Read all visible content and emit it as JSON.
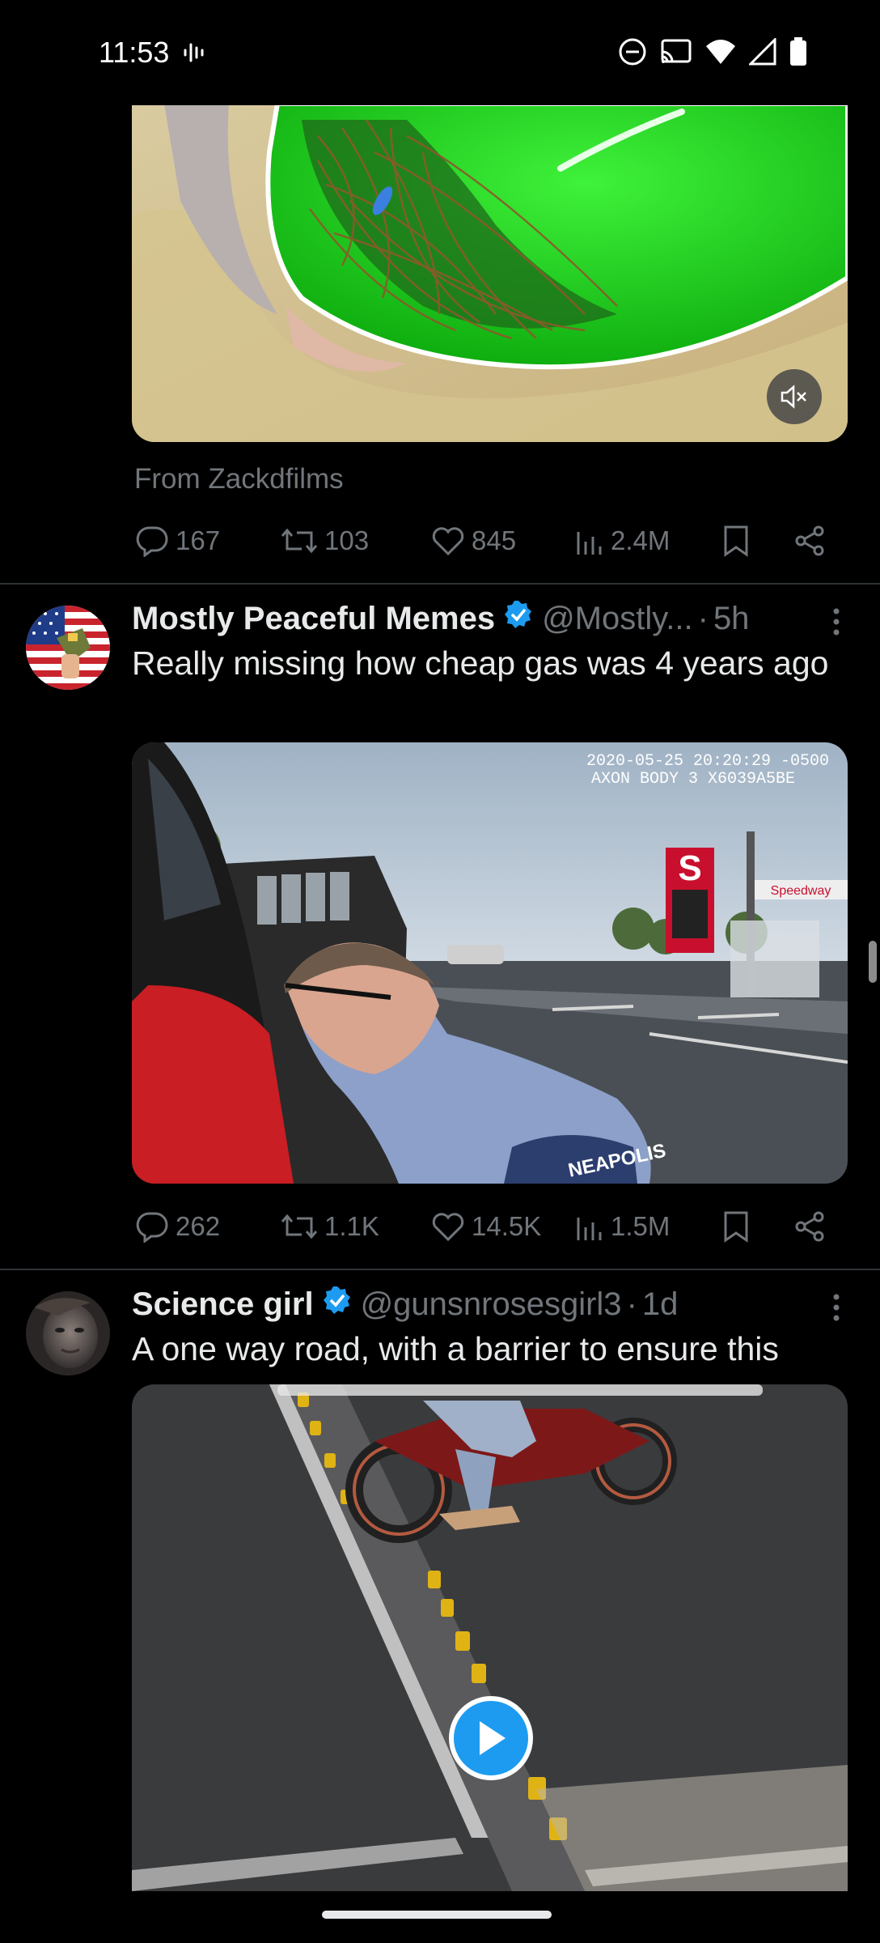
{
  "status_bar": {
    "time": "11:53",
    "icons": [
      "voice-wave-icon",
      "do-not-disturb-icon",
      "cast-icon",
      "wifi-icon",
      "signal-icon",
      "battery-icon"
    ]
  },
  "tweets": [
    {
      "media_caption": "From Zackdfilms",
      "stats": {
        "replies": "167",
        "retweets": "103",
        "likes": "845",
        "views": "2.4M"
      }
    },
    {
      "author": "Mostly Peaceful Memes",
      "handle": "@Mostly...",
      "dot": "·",
      "time": "5h",
      "text": "Really missing how cheap gas was 4 years ago",
      "media_overlay": {
        "timestamp": "2020-05-25 20:20:29 -0500",
        "device": "AXON BODY 3 X6039A5BE",
        "sign_brand": "Speedway",
        "patch_text": "NEAPOLIS"
      },
      "stats": {
        "replies": "262",
        "retweets": "1.1K",
        "likes": "14.5K",
        "views": "1.5M"
      }
    },
    {
      "author": "Science girl",
      "handle": "@gunsnrosesgirl3",
      "dot": "·",
      "time": "1d",
      "text": "A one way road, with a barrier to ensure this"
    }
  ],
  "colors": {
    "accent": "#1d9bf0",
    "muted": "#71767b",
    "divider": "#2f3336",
    "text": "#e7e9ea"
  }
}
